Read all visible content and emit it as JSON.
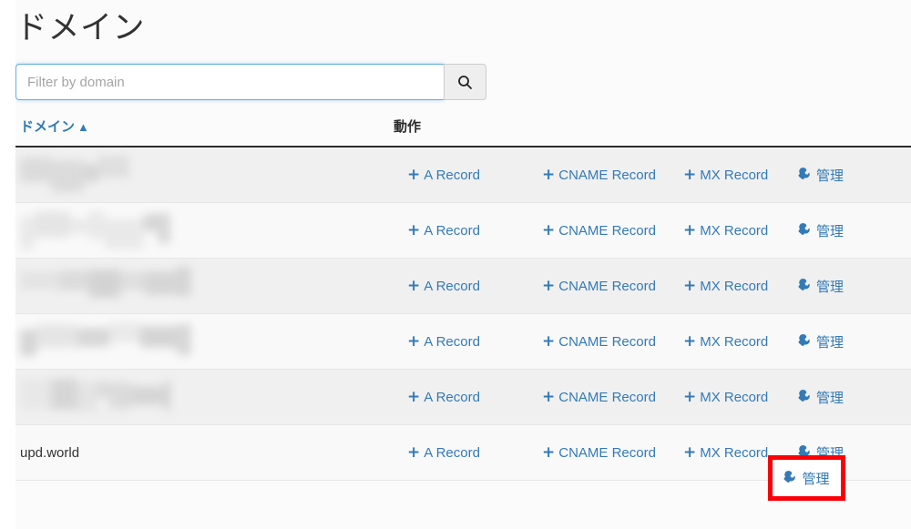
{
  "page": {
    "title": "ドメイン",
    "background": "#fbfbfb"
  },
  "filter": {
    "placeholder": "Filter by domain",
    "value": "",
    "search_button_icon": "search-icon",
    "border_focus_color": "#66afe9"
  },
  "table": {
    "columns": [
      {
        "key": "domain",
        "label": "ドメイン",
        "sortable": true,
        "sort_direction": "asc",
        "sort_caret": "▲",
        "link_color": "#337ab7"
      },
      {
        "key": "actions",
        "label": "動作",
        "sortable": false
      }
    ],
    "action_labels": {
      "a_record": "A Record",
      "cname_record": "CNAME Record",
      "mx_record": "MX Record",
      "manage": "管理"
    },
    "action_icons": {
      "a_record": "plus-icon",
      "cname_record": "plus-icon",
      "mx_record": "plus-icon",
      "manage": "wrench-icon"
    },
    "plus_glyph": "+",
    "rows": [
      {
        "domain": "",
        "redacted": true,
        "redacted_width": 120
      },
      {
        "domain": "",
        "redacted": true,
        "redacted_width": 165
      },
      {
        "domain": "",
        "redacted": true,
        "redacted_width": 188
      },
      {
        "domain": "",
        "redacted": true,
        "redacted_width": 188
      },
      {
        "domain": "",
        "redacted": true,
        "redacted_width": 165
      },
      {
        "domain": "upd.world",
        "redacted": false,
        "redacted_width": 0
      }
    ]
  },
  "highlight": {
    "target_row_index": 5,
    "target_action": "manage",
    "label": "管理",
    "color": "#fb0007"
  }
}
